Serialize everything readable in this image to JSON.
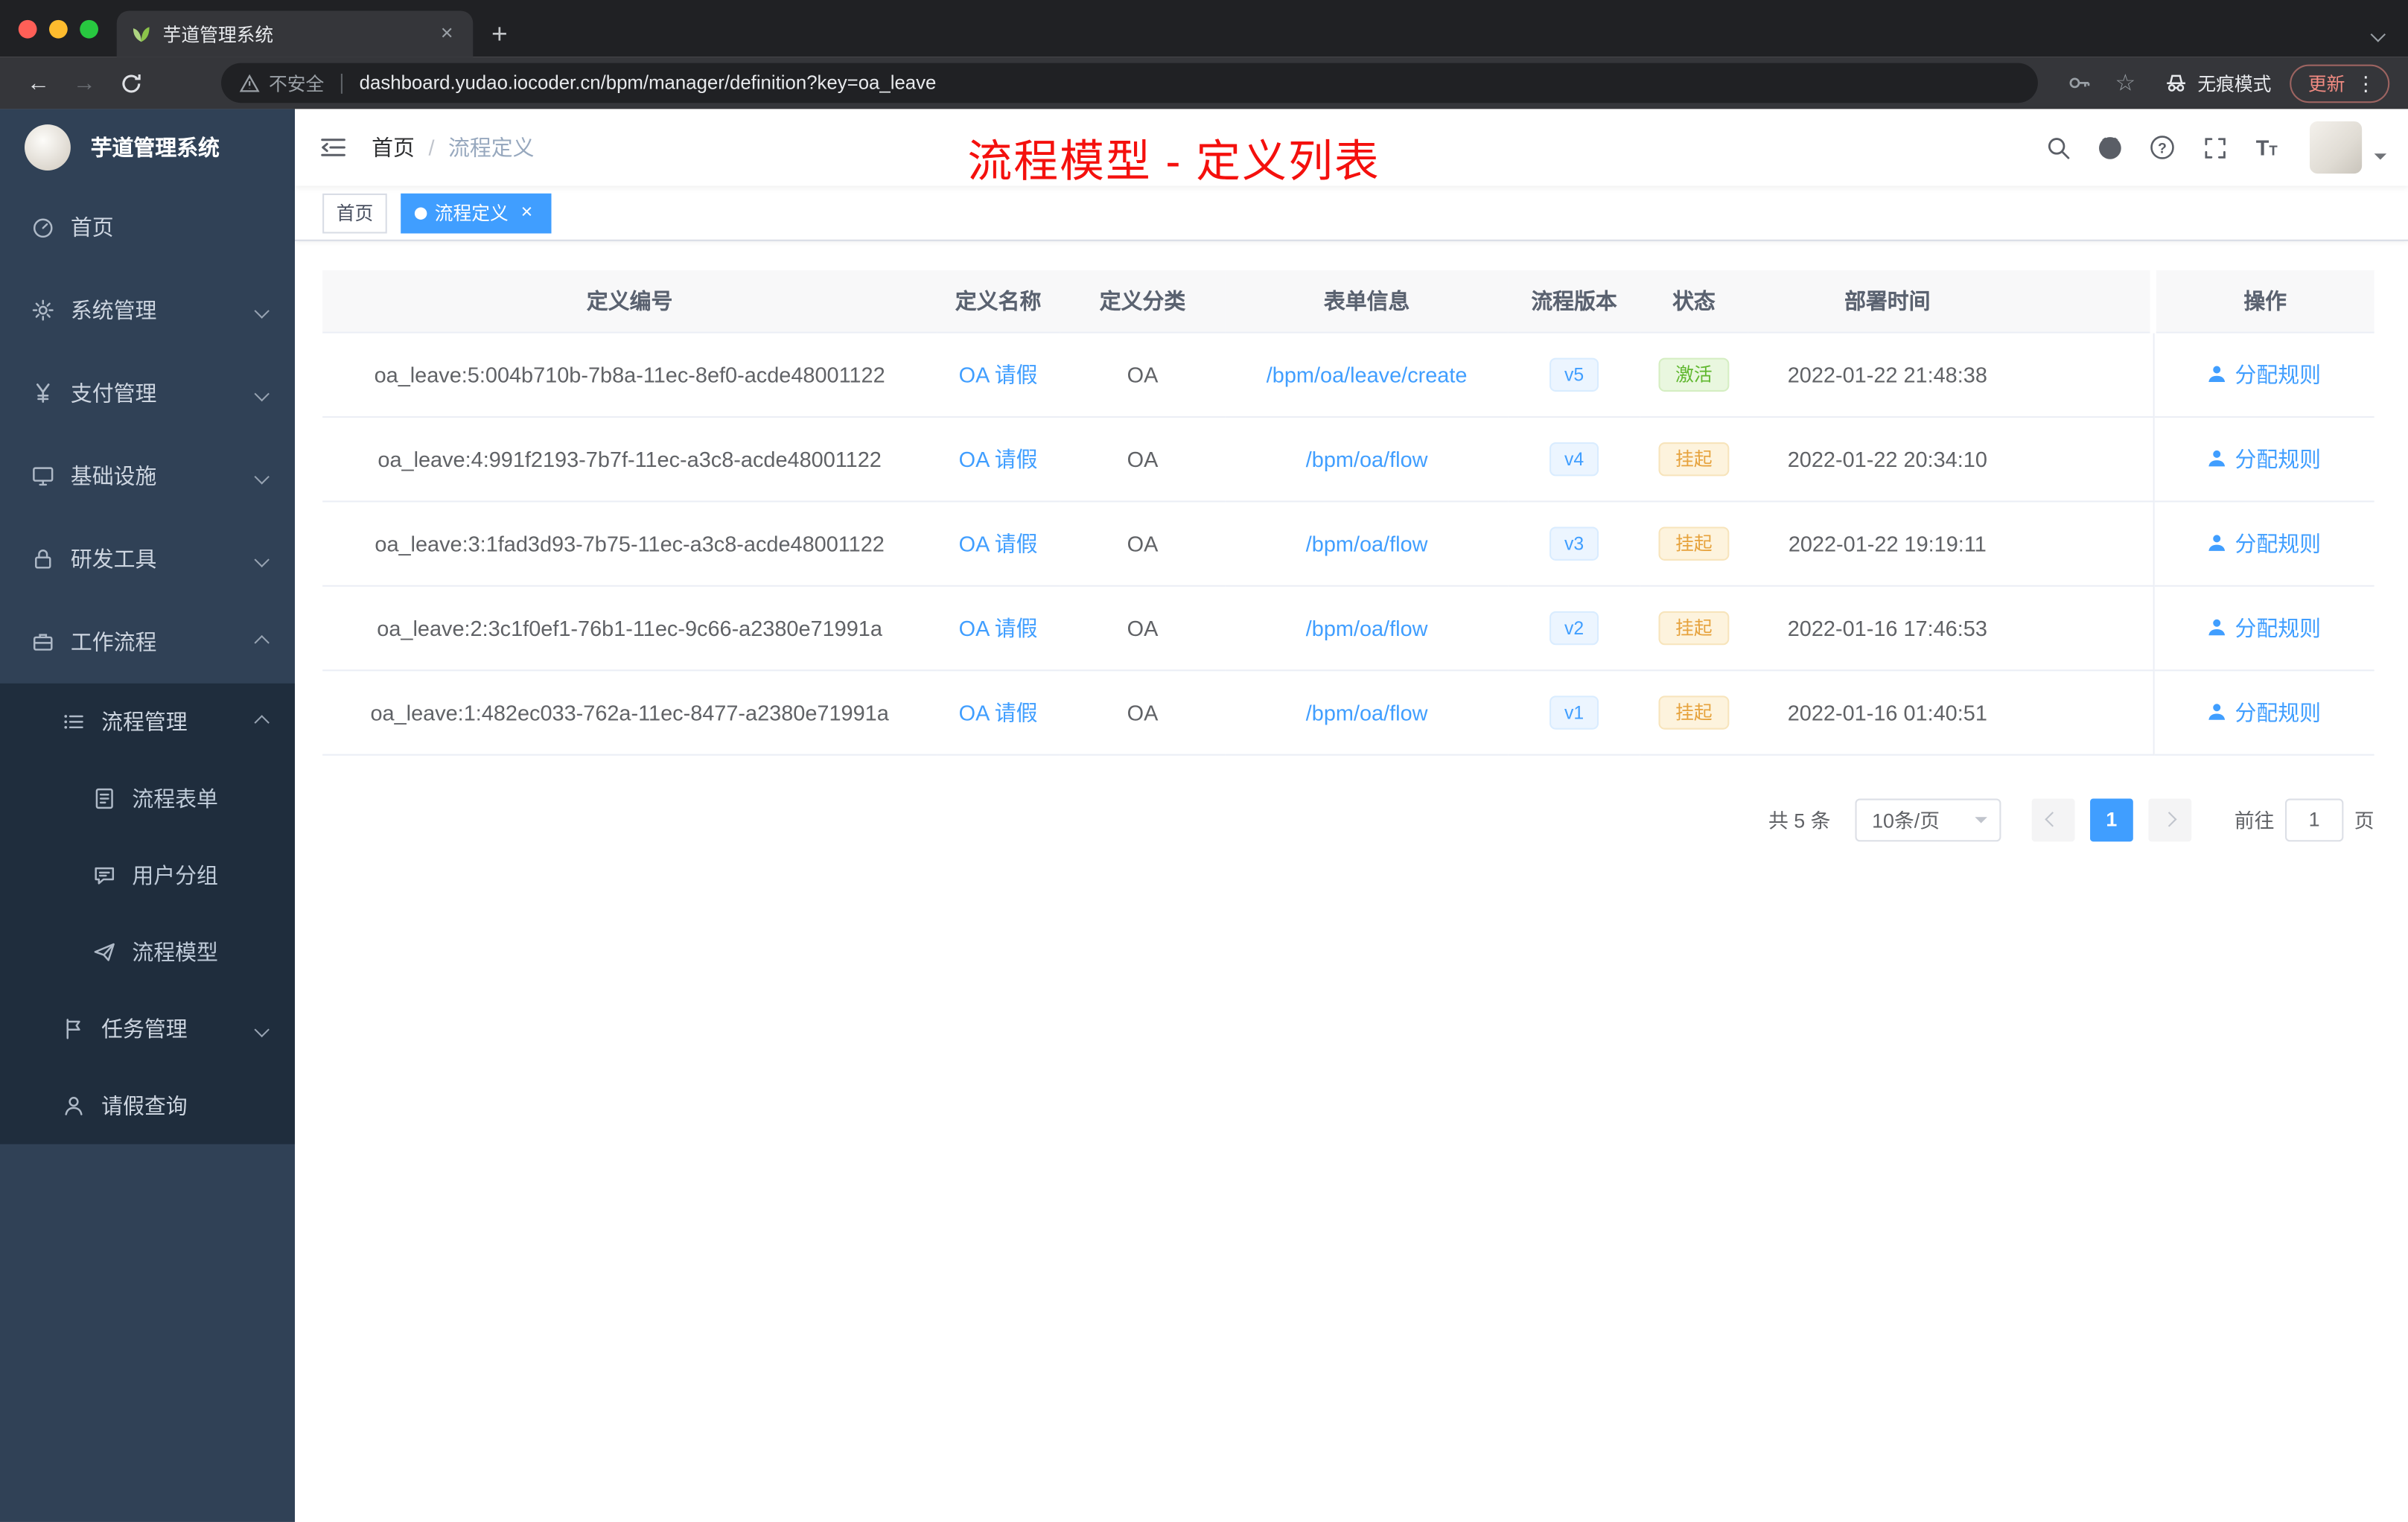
{
  "colors": {
    "accent": "#409eff",
    "annotation_red": "#f4100d",
    "sidebar_bg": "#304156",
    "submenu_bg": "#1f2d3d",
    "status_active": "#67c23a",
    "status_suspended": "#e6a23c"
  },
  "browser": {
    "tab_title": "芋道管理系统",
    "security_label": "不安全",
    "url": "dashboard.yudao.iocoder.cn/bpm/manager/definition?key=oa_leave",
    "incognito_label": "无痕模式",
    "update_label": "更新"
  },
  "sidebar": {
    "logo_title": "芋道管理系统",
    "items": [
      {
        "label": "首页",
        "icon": "dashboard-icon"
      },
      {
        "label": "系统管理",
        "icon": "gear-icon"
      },
      {
        "label": "支付管理",
        "icon": "payment-icon"
      },
      {
        "label": "基础设施",
        "icon": "infrastructure-icon"
      },
      {
        "label": "研发工具",
        "icon": "devtools-icon"
      },
      {
        "label": "工作流程",
        "icon": "workflow-icon"
      },
      {
        "label": "流程管理",
        "icon": "process-list-icon"
      },
      {
        "label": "流程表单",
        "icon": "form-icon"
      },
      {
        "label": "用户分组",
        "icon": "user-group-icon"
      },
      {
        "label": "流程模型",
        "icon": "paper-plane-icon"
      },
      {
        "label": "任务管理",
        "icon": "flag-icon"
      },
      {
        "label": "请假查询",
        "icon": "person-icon"
      }
    ]
  },
  "header": {
    "breadcrumb_home": "首页",
    "breadcrumb_separator": "/",
    "breadcrumb_current": "流程定义",
    "annotation": "流程模型 - 定义列表",
    "icons": [
      "search-icon",
      "github-icon",
      "question-icon",
      "fullscreen-icon",
      "font-size-icon"
    ]
  },
  "tags": {
    "home": "首页",
    "current": "流程定义"
  },
  "table": {
    "columns": [
      "定义编号",
      "定义名称",
      "定义分类",
      "表单信息",
      "流程版本",
      "状态",
      "部署时间",
      "操作"
    ],
    "rows": [
      {
        "id": "oa_leave:5:004b710b-7b8a-11ec-8ef0-acde48001122",
        "name": "OA 请假",
        "category": "OA",
        "form": "/bpm/oa/leave/create",
        "version": "v5",
        "status": "激活",
        "status_type": "success",
        "deployed_at": "2022-01-22 21:48:38",
        "action": "分配规则"
      },
      {
        "id": "oa_leave:4:991f2193-7b7f-11ec-a3c8-acde48001122",
        "name": "OA 请假",
        "category": "OA",
        "form": "/bpm/oa/flow",
        "version": "v4",
        "status": "挂起",
        "status_type": "warning",
        "deployed_at": "2022-01-22 20:34:10",
        "action": "分配规则"
      },
      {
        "id": "oa_leave:3:1fad3d93-7b75-11ec-a3c8-acde48001122",
        "name": "OA 请假",
        "category": "OA",
        "form": "/bpm/oa/flow",
        "version": "v3",
        "status": "挂起",
        "status_type": "warning",
        "deployed_at": "2022-01-22 19:19:11",
        "action": "分配规则"
      },
      {
        "id": "oa_leave:2:3c1f0ef1-76b1-11ec-9c66-a2380e71991a",
        "name": "OA 请假",
        "category": "OA",
        "form": "/bpm/oa/flow",
        "version": "v2",
        "status": "挂起",
        "status_type": "warning",
        "deployed_at": "2022-01-16 17:46:53",
        "action": "分配规则"
      },
      {
        "id": "oa_leave:1:482ec033-762a-11ec-8477-a2380e71991a",
        "name": "OA 请假",
        "category": "OA",
        "form": "/bpm/oa/flow",
        "version": "v1",
        "status": "挂起",
        "status_type": "warning",
        "deployed_at": "2022-01-16 01:40:51",
        "action": "分配规则"
      }
    ]
  },
  "pagination": {
    "total": "共 5 条",
    "page_size": "10条/页",
    "current_page": "1",
    "goto_label": "前往",
    "goto_value": "1",
    "unit": "页"
  }
}
